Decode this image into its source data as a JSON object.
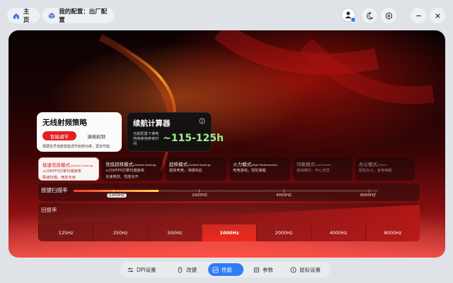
{
  "top": {
    "home_label": "主页",
    "config_label": "我的配置：出厂配置"
  },
  "strategy": {
    "title": "无线射频策略",
    "smart_label": "智能调节",
    "full_label": "满格射频",
    "desc": "根据信号强度智能调节射频功率，更加节能"
  },
  "battery": {
    "title": "续航计算器",
    "desc": "当前配置下满电持续使用参考时间",
    "value": "~115-125h"
  },
  "modes": [
    {
      "name": "极速竞技模式",
      "sub": "(Corded Gaming)",
      "desc1": "≥20KFPS引擎扫描速率",
      "desc2": "瞬速扫描，竞技专用",
      "state": "active"
    },
    {
      "name": "竞技超核模式",
      "sub": "(Corded Gaming)",
      "desc1": "≥15KFPS引擎扫描速率",
      "desc2": "全速竞技，性能全开",
      "state": "normal"
    },
    {
      "name": "超核模式",
      "sub": "(Corded Gaming)",
      "desc1": "超核电竞，滑顺响应",
      "desc2": "",
      "state": "normal"
    },
    {
      "name": "火力模式",
      "sub": "(High Performance)",
      "desc1": "电竞游戏，轻松掌握",
      "desc2": "",
      "state": "normal"
    },
    {
      "name": "均衡模式",
      "sub": "(Low Power)",
      "desc1": "游戏娱乐，开心无忧",
      "desc2": "",
      "state": "dim"
    },
    {
      "name": "办公模式",
      "sub": "(Other)",
      "desc1": "轻松办公，省电续航",
      "desc2": "",
      "state": "dim"
    }
  ],
  "scan": {
    "label": "按键扫描率",
    "ticks": [
      "1000HZ",
      "2000HZ",
      "4000HZ",
      "8000HZ"
    ],
    "selected_index": 0,
    "level": 0.28
  },
  "report": {
    "label": "回报率",
    "options": [
      "125Hz",
      "250Hz",
      "500Hz",
      "1000Hz",
      "2000Hz",
      "4000Hz",
      "8000Hz"
    ],
    "selected_index": 3
  },
  "nav": {
    "dpi": "DPI设置",
    "keys": "改键",
    "perf": "性能",
    "params": "参数",
    "mouse": "鼠标设置"
  },
  "colors": {
    "accent": "#e62020",
    "nav_active": "#2e7df6",
    "battery_value": "#9ef08f"
  }
}
